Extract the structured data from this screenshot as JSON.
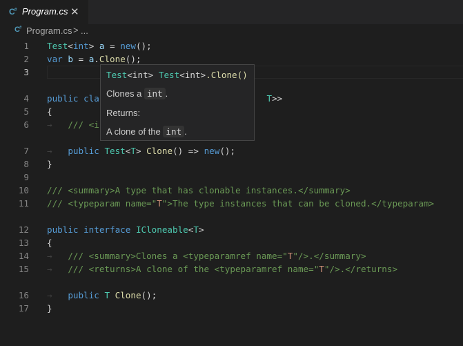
{
  "tab": {
    "icon": "csharp-icon",
    "title": "Program.cs",
    "close": "✕"
  },
  "breadcrumb": {
    "file": "Program.cs",
    "separator": ">",
    "more": "..."
  },
  "colors": {
    "keyword": "#569cd6",
    "type": "#4ec9b0",
    "function": "#dcdcaa",
    "variable": "#9cdcfe",
    "comment": "#6a9955",
    "string": "#ce9178",
    "text": "#d4d4d4"
  },
  "lines": [
    {
      "n": "1",
      "tokens": [
        [
          "ty",
          "Test"
        ],
        [
          "pl",
          "<"
        ],
        [
          "kw",
          "int"
        ],
        [
          "pl",
          "> "
        ],
        [
          "vr",
          "a"
        ],
        [
          "pl",
          " = "
        ],
        [
          "kw",
          "new"
        ],
        [
          "pl",
          "();"
        ]
      ]
    },
    {
      "n": "2",
      "tokens": [
        [
          "kw",
          "var"
        ],
        [
          "pl",
          " "
        ],
        [
          "vr",
          "b"
        ],
        [
          "pl",
          " = "
        ],
        [
          "vr",
          "a"
        ],
        [
          "pl",
          "."
        ],
        [
          "fn",
          "Clone"
        ],
        [
          "pl",
          "();"
        ]
      ]
    },
    {
      "n": "3",
      "tokens": []
    },
    {
      "n": "4",
      "tokens": [
        [
          "kw",
          "public"
        ],
        [
          "pl",
          " "
        ],
        [
          "kw",
          "cla"
        ],
        [
          "pl",
          "                                "
        ],
        [
          "ty",
          "T"
        ],
        [
          "pl",
          ">>"
        ]
      ]
    },
    {
      "n": "5",
      "tokens": [
        [
          "pl",
          "{"
        ]
      ]
    },
    {
      "n": "6",
      "tokens": [
        [
          "pl",
          "    "
        ],
        [
          "cm",
          "/// <i"
        ]
      ]
    },
    {
      "n": "7",
      "tokens": [
        [
          "pl",
          "    "
        ],
        [
          "kw",
          "public"
        ],
        [
          "pl",
          " "
        ],
        [
          "ty",
          "Test"
        ],
        [
          "pl",
          "<"
        ],
        [
          "ty",
          "T"
        ],
        [
          "pl",
          "> "
        ],
        [
          "fn",
          "Clone"
        ],
        [
          "pl",
          "() => "
        ],
        [
          "kw",
          "new"
        ],
        [
          "pl",
          "();"
        ]
      ]
    },
    {
      "n": "8",
      "tokens": [
        [
          "pl",
          "}"
        ]
      ]
    },
    {
      "n": "9",
      "tokens": []
    },
    {
      "n": "10",
      "tokens": [
        [
          "cm",
          "/// <summary>A type that has clonable instances.</summary>"
        ]
      ]
    },
    {
      "n": "11",
      "tokens": [
        [
          "cm",
          "/// <typeparam name=\""
        ],
        [
          "st",
          "T"
        ],
        [
          "cm",
          "\">The type instances that can be cloned.</typeparam>"
        ]
      ]
    },
    {
      "n": "12",
      "tokens": [
        [
          "kw",
          "public"
        ],
        [
          "pl",
          " "
        ],
        [
          "kw",
          "interface"
        ],
        [
          "pl",
          " "
        ],
        [
          "ty",
          "ICloneable"
        ],
        [
          "pl",
          "<"
        ],
        [
          "ty",
          "T"
        ],
        [
          "pl",
          ">"
        ]
      ]
    },
    {
      "n": "13",
      "tokens": [
        [
          "pl",
          "{"
        ]
      ]
    },
    {
      "n": "14",
      "tokens": [
        [
          "pl",
          "    "
        ],
        [
          "cm",
          "/// <summary>Clones a <typeparamref name=\""
        ],
        [
          "st",
          "T"
        ],
        [
          "cm",
          "\"/>.</summary>"
        ]
      ]
    },
    {
      "n": "15",
      "tokens": [
        [
          "pl",
          "    "
        ],
        [
          "cm",
          "/// <returns>A clone of the <typeparamref name=\""
        ],
        [
          "st",
          "T"
        ],
        [
          "cm",
          "\"/>.</returns>"
        ]
      ]
    },
    {
      "n": "16",
      "tokens": [
        [
          "pl",
          "    "
        ],
        [
          "kw",
          "public"
        ],
        [
          "pl",
          " "
        ],
        [
          "ty",
          "T"
        ],
        [
          "pl",
          " "
        ],
        [
          "fn",
          "Clone"
        ],
        [
          "pl",
          "();"
        ]
      ]
    },
    {
      "n": "17",
      "tokens": [
        [
          "pl",
          "}"
        ]
      ]
    }
  ],
  "hover": {
    "sig_type1": "Test",
    "sig_generic1": "<int>",
    "sig_type2": "Test",
    "sig_generic2": "<int>",
    "sig_method": ".Clone()",
    "desc_prefix": "Clones a ",
    "desc_code": "int",
    "desc_suffix": ".",
    "returns_label": "Returns:",
    "ret_prefix": "A clone of the ",
    "ret_code": "int",
    "ret_suffix": "."
  }
}
